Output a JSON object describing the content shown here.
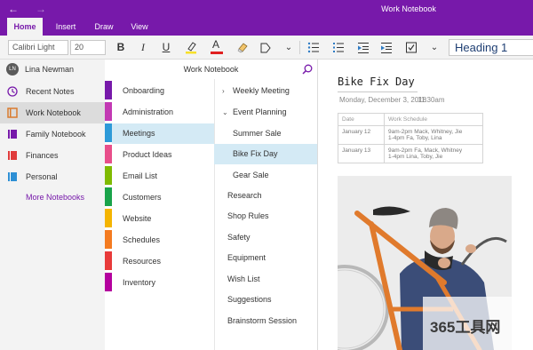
{
  "titlebar": {
    "title": "Work Notebook"
  },
  "tabs": [
    {
      "label": "Home"
    },
    {
      "label": "Insert"
    },
    {
      "label": "Draw"
    },
    {
      "label": "View"
    }
  ],
  "ribbon": {
    "font_name": "Calibri Light",
    "font_size": "20",
    "bold": "B",
    "italic": "I",
    "underline": "U",
    "font_color": "A",
    "more": "⌄",
    "style": "Heading 1"
  },
  "user": {
    "initials": "LN",
    "name": "Lina Newman"
  },
  "notebooks": [
    {
      "label": "Recent Notes",
      "icon": "clock-icon",
      "color": "#7719aa"
    },
    {
      "label": "Work Notebook",
      "icon": "notebook-icon",
      "color": "#d97b2e"
    },
    {
      "label": "Family Notebook",
      "icon": "notebook-icon",
      "color": "#7719aa"
    },
    {
      "label": "Finances",
      "icon": "notebook-icon",
      "color": "#e03a3a"
    },
    {
      "label": "Personal",
      "icon": "notebook-icon",
      "color": "#2d8fd5"
    }
  ],
  "more_notebooks": "More Notebooks",
  "notebook_title": "Work Notebook",
  "sections": [
    {
      "label": "Onboarding",
      "color": "#7719aa"
    },
    {
      "label": "Administration",
      "color": "#c239b3"
    },
    {
      "label": "Meetings",
      "color": "#2d9ad8"
    },
    {
      "label": "Product Ideas",
      "color": "#e84e8a"
    },
    {
      "label": "Email List",
      "color": "#7fba00"
    },
    {
      "label": "Customers",
      "color": "#19a34a"
    },
    {
      "label": "Website",
      "color": "#f4b400"
    },
    {
      "label": "Schedules",
      "color": "#f47b20"
    },
    {
      "label": "Resources",
      "color": "#e83a3a"
    },
    {
      "label": "Inventory",
      "color": "#b4009e"
    }
  ],
  "pages": [
    {
      "label": "Weekly Meeting",
      "chevron": "›"
    },
    {
      "label": "Event Planning",
      "chevron": "⌄"
    },
    {
      "label": "Summer Sale",
      "chevron": ""
    },
    {
      "label": "Bike Fix Day",
      "chevron": ""
    },
    {
      "label": "Gear Sale",
      "chevron": ""
    },
    {
      "label": "Research",
      "chevron": ""
    },
    {
      "label": "Shop Rules",
      "chevron": ""
    },
    {
      "label": "Safety",
      "chevron": ""
    },
    {
      "label": "Equipment",
      "chevron": ""
    },
    {
      "label": "Wish List",
      "chevron": ""
    },
    {
      "label": "Suggestions",
      "chevron": ""
    },
    {
      "label": "Brainstorm Session",
      "chevron": ""
    }
  ],
  "page": {
    "title": "Bike Fix Day",
    "date": "Monday, December 3, 2018",
    "time": "11:30am",
    "table": {
      "headers": [
        "Date",
        "Work Schedule"
      ],
      "rows": [
        [
          "January 12",
          "9am-2pm Mack, Whitney, Jie",
          "1-4pm Fa, Toby, Lina"
        ],
        [
          "January 13",
          "9am-2pm Fa, Mack, Whitney",
          "1-4pm Lina, Toby, Jie"
        ]
      ]
    }
  },
  "watermark": "365工具网",
  "colors": {
    "accent": "#7719aa",
    "selection": "#d4eaf5"
  }
}
